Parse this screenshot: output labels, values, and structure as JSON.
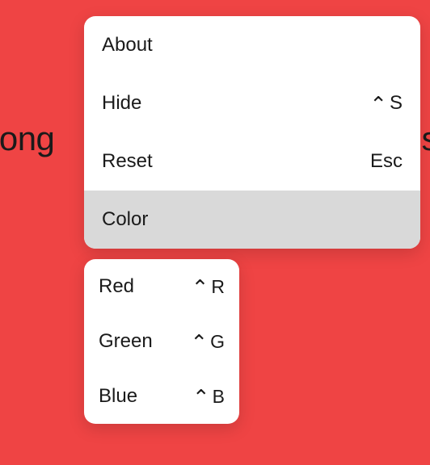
{
  "background": {
    "color": "#ef4444",
    "text_left": "long",
    "text_right": "s"
  },
  "menu": {
    "items": [
      {
        "label": "About",
        "shortcut": ""
      },
      {
        "label": "Hide",
        "shortcut_symbol": "⌃",
        "shortcut_key": "S"
      },
      {
        "label": "Reset",
        "shortcut": "Esc"
      },
      {
        "label": "Color",
        "shortcut": "",
        "highlighted": true
      }
    ]
  },
  "submenu": {
    "items": [
      {
        "label": "Red",
        "shortcut_symbol": "⌃",
        "shortcut_key": "R"
      },
      {
        "label": "Green",
        "shortcut_symbol": "⌃",
        "shortcut_key": "G"
      },
      {
        "label": "Blue",
        "shortcut_symbol": "⌃",
        "shortcut_key": "B"
      }
    ]
  }
}
